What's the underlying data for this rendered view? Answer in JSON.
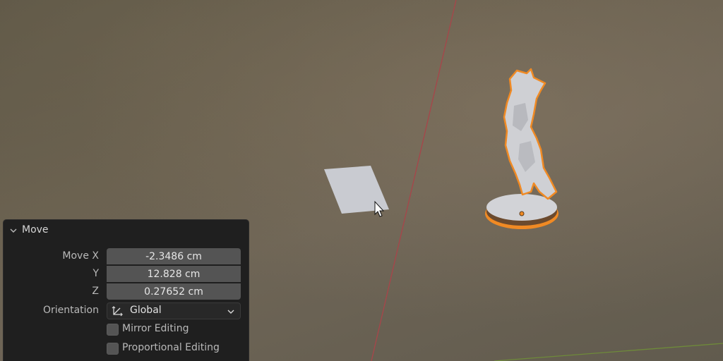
{
  "panel": {
    "title": "Move",
    "move_x_label": "Move X",
    "move_x_value": "-2.3486 cm",
    "y_label": "Y",
    "y_value": "12.828 cm",
    "z_label": "Z",
    "z_value": "0.27652 cm",
    "orientation_label": "Orientation",
    "orientation_value": "Global",
    "mirror_editing_label": "Mirror Editing",
    "mirror_editing_checked": false,
    "proportional_editing_label": "Proportional Editing",
    "proportional_editing_checked": false
  },
  "scene": {
    "selection_outline_color": "#f08a24",
    "x_axis_color": "#a8454a",
    "y_axis_color": "#6e8a3a",
    "objects": [
      "plane",
      "horse-statue"
    ]
  },
  "icons": [
    "chevron-down-icon",
    "orientation-axes-icon",
    "dropdown-arrow-icon",
    "mouse-cursor-icon"
  ]
}
